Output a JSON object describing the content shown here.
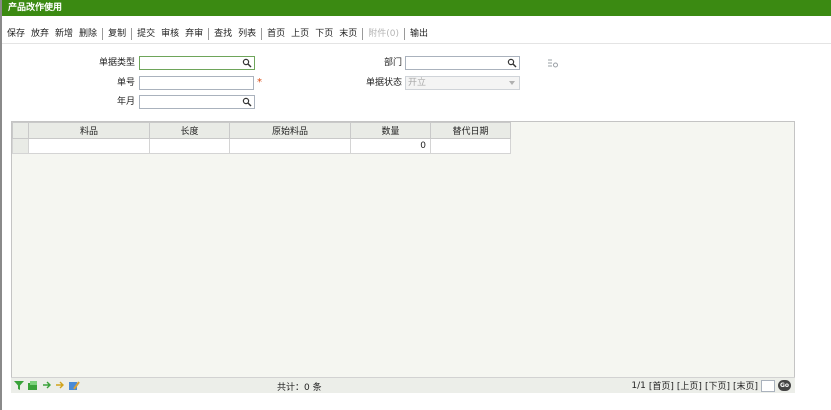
{
  "title": "产品改作使用",
  "toolbar": {
    "groups": [
      [
        "保存",
        "放弃",
        "新增",
        "删除"
      ],
      [
        "复制"
      ],
      [
        "提交",
        "审核",
        "弃审"
      ],
      [
        "查找",
        "列表"
      ],
      [
        "首页",
        "上页",
        "下页",
        "末页"
      ],
      [
        "附件(0)"
      ],
      [
        "输出"
      ]
    ],
    "disabled": [
      "附件(0)"
    ]
  },
  "form": {
    "doc_type_label": "单据类型",
    "doc_type_value": "",
    "doc_no_label": "单号",
    "doc_no_value": "",
    "required_mark": "*",
    "year_month_label": "年月",
    "year_month_value": "",
    "dept_label": "部门",
    "dept_value": "",
    "doc_status_label": "单据状态",
    "doc_status_value": "开立"
  },
  "grid": {
    "columns": [
      "料品",
      "长度",
      "原始料品",
      "数量",
      "替代日期"
    ],
    "rows": [
      [
        "",
        "",
        "",
        "0",
        ""
      ]
    ]
  },
  "status": {
    "total": "共计：0 条",
    "page": "1/1",
    "first": "[首页]",
    "prev": "[上页]",
    "next": "[下页]",
    "last": "[末页]",
    "go": "Go"
  },
  "colors": {
    "title_bar": "#3b8a12",
    "required": "#d84b14"
  },
  "icons": [
    "search-icon",
    "dropdown-arrow-icon",
    "settings-icon",
    "filter-icon",
    "export-icon",
    "column-icon",
    "tool-icon",
    "go-icon"
  ]
}
